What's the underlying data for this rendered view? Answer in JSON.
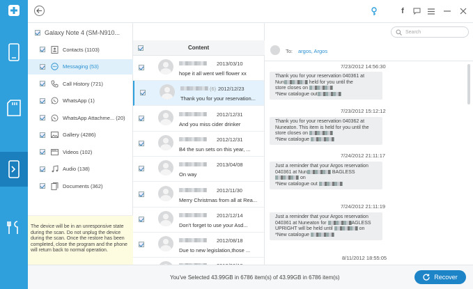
{
  "device": {
    "name": "Galaxy Note 4 (SM-N910..."
  },
  "categories": [
    {
      "label": "Contacts (1103)",
      "icon": "contacts-icon",
      "active": false
    },
    {
      "label": "Messaging (53)",
      "icon": "message-icon",
      "active": true
    },
    {
      "label": "Call History (721)",
      "icon": "phone-icon",
      "active": false
    },
    {
      "label": "WhatsApp (1)",
      "icon": "whatsapp-icon",
      "active": false
    },
    {
      "label": "WhatsApp Attachme... (20)",
      "icon": "whatsapp-icon",
      "active": false
    },
    {
      "label": "Gallery (4286)",
      "icon": "image-icon",
      "active": false
    },
    {
      "label": "Videos (102)",
      "icon": "video-icon",
      "active": false
    },
    {
      "label": "Audio (138)",
      "icon": "music-icon",
      "active": false
    },
    {
      "label": "Documents (362)",
      "icon": "document-icon",
      "active": false
    }
  ],
  "warning": "The device will be in an unresponsive state during the scan. Do not unplug the device during the scan. Once the restore has been completed, close the program and the phone will return back to normal operation.",
  "list": {
    "header": "Content",
    "messages": [
      {
        "date": "2013/03/10",
        "text": "hope it all went well flower xx",
        "selected": false
      },
      {
        "date": "2012/12/23",
        "text": "Thank you for your reservation...",
        "selected": true,
        "sender_suffix": "(6)"
      },
      {
        "date": "2012/12/31",
        "text": "And you miss cider drinker",
        "selected": false
      },
      {
        "date": "2012/12/31",
        "text": "B4 the sun sets on this year, ...",
        "selected": false
      },
      {
        "date": "2013/04/08",
        "text": "On way",
        "selected": false
      },
      {
        "date": "2012/11/30",
        "text": "Merry Christmas from all at Rea...",
        "selected": false
      },
      {
        "date": "2012/12/14",
        "text": "Don't forget to use your Asd...",
        "selected": false
      },
      {
        "date": "2012/08/18",
        "text": "Due to new legislation,those ...",
        "selected": false
      },
      {
        "date": "2012/08/18",
        "text": "",
        "selected": false
      }
    ]
  },
  "conversation": {
    "to_label": "To:",
    "recipients": "argos, Argos",
    "entries": [
      {
        "time": "7/23/2012 14:56:30",
        "lines": [
          "Thank you for your reservation 040361 at",
          "Nun[mask] held for you until the",
          "store closes on [mask]",
          "*New catalogue out[mask]"
        ]
      },
      {
        "time": "7/23/2012 15:12:12",
        "lines": [
          "Thank you for your reservation 040362 at",
          "Nuneaton. This item is held for you until the",
          "store closes on [mask]",
          "*New catalogue [mask]"
        ]
      },
      {
        "time": "7/24/2012 21:11:17",
        "lines": [
          "Just a reminder that your Argos reservation",
          "040361 at Nun[mask] BAGLESS",
          "[mask] on",
          "*New catalogue out [mask]"
        ]
      },
      {
        "time": "7/24/2012 21:11:19",
        "lines": [
          "Just a reminder that your Argos reservation",
          "040361 at Nuneaton for [mask]AGLESS",
          "UPRIGHT will be held until [mask] on",
          "*New catalogue [mask]"
        ]
      },
      {
        "time": "8/11/2012 18:55:05",
        "lines": []
      }
    ]
  },
  "search": {
    "placeholder": "Search"
  },
  "status": "You've Selected 43.99GB in 6786 item(s) of 43.99GB in 6786 item(s)",
  "recover_label": "Recover",
  "colors": {
    "accent": "#2fa0db",
    "rail": "#2fa0db",
    "button": "#1d84c8"
  }
}
